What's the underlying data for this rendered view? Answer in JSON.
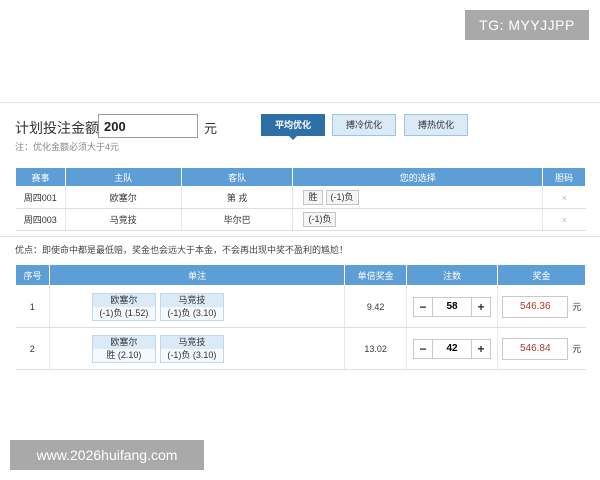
{
  "watermarks": {
    "top": "TG: MYYJJPP",
    "bottom": "www.2026huifang.com"
  },
  "plan": {
    "label": "计划投注金额",
    "amount": "200",
    "unit": "元",
    "note": "注：优化金额必须大于4元"
  },
  "optimize_buttons": [
    {
      "label": "平均优化",
      "active": true
    },
    {
      "label": "搏冷优化",
      "active": false
    },
    {
      "label": "搏热优化",
      "active": false
    }
  ],
  "matches": {
    "headers": [
      "赛事",
      "主队",
      "客队",
      "您的选择",
      "胆码"
    ],
    "rows": [
      {
        "event": "周四001",
        "home": "欧塞尔",
        "away": "第 戎",
        "choices": [
          "胜",
          "(-1)负"
        ],
        "dan": "×"
      },
      {
        "event": "周四003",
        "home": "马竞技",
        "away": "毕尔巴",
        "choices": [
          "(-1)负"
        ],
        "dan": "×"
      }
    ]
  },
  "warning": "优点：即使命中都是最低赔，奖金也会远大于本金，不会再出现中奖不盈利的尴尬！",
  "results": {
    "headers": [
      "序号",
      "单注",
      "单倍奖金",
      "注数",
      "奖金"
    ],
    "rows": [
      {
        "index": "1",
        "picks": [
          {
            "team": "欧塞尔",
            "bet": "(-1)负 (1.52)"
          },
          {
            "team": "马竞技",
            "bet": "(-1)负 (3.10)"
          }
        ],
        "single_prize": "9.42",
        "count": "58",
        "prize": "546.36",
        "unit": "元"
      },
      {
        "index": "2",
        "picks": [
          {
            "team": "欧塞尔",
            "bet": "胜 (2.10)"
          },
          {
            "team": "马竞技",
            "bet": "(-1)负 (3.10)"
          }
        ],
        "single_prize": "13.02",
        "count": "42",
        "prize": "546.84",
        "unit": "元"
      }
    ],
    "minus": "−",
    "plus": "+"
  }
}
